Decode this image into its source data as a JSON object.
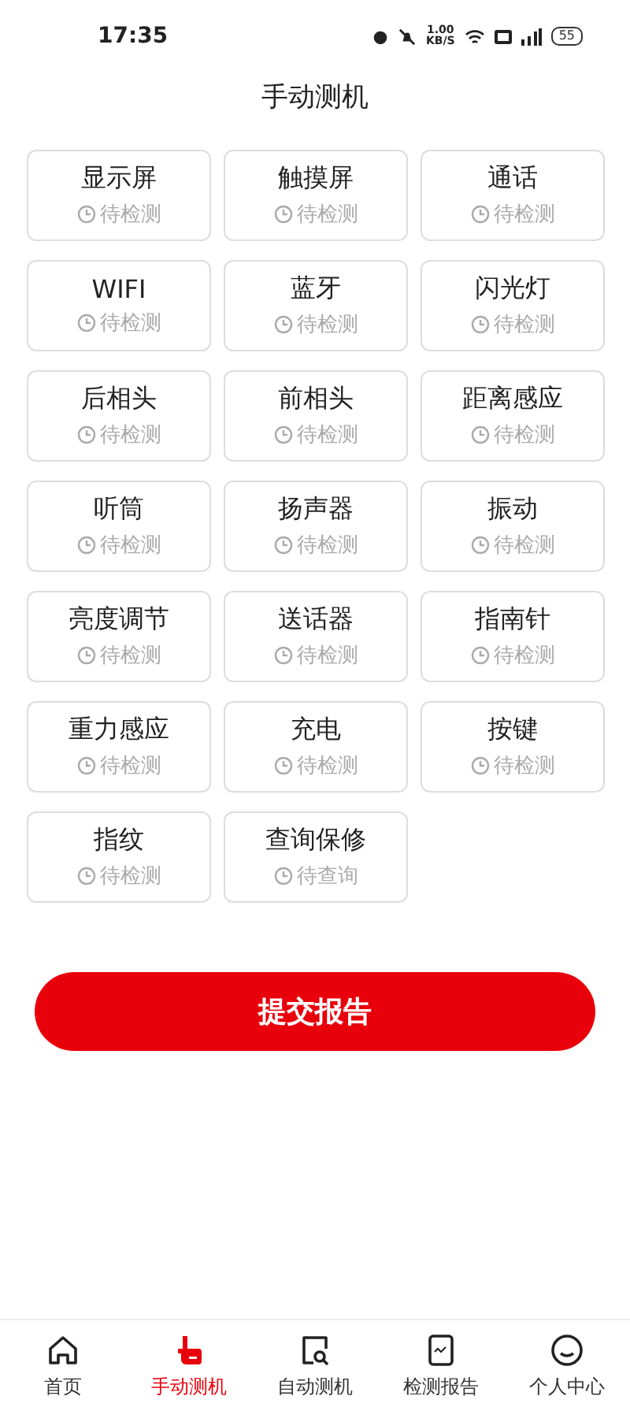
{
  "status_bar": {
    "time": "17:35",
    "net_speed": "1.00",
    "net_unit": "KB/S",
    "battery": "55"
  },
  "header": {
    "title": "手动测机"
  },
  "tests": [
    {
      "name": "显示屏",
      "status": "待检测"
    },
    {
      "name": "触摸屏",
      "status": "待检测"
    },
    {
      "name": "通话",
      "status": "待检测"
    },
    {
      "name": "WIFI",
      "status": "待检测"
    },
    {
      "name": "蓝牙",
      "status": "待检测"
    },
    {
      "name": "闪光灯",
      "status": "待检测"
    },
    {
      "name": "后相头",
      "status": "待检测"
    },
    {
      "name": "前相头",
      "status": "待检测"
    },
    {
      "name": "距离感应",
      "status": "待检测"
    },
    {
      "name": "听筒",
      "status": "待检测"
    },
    {
      "name": "扬声器",
      "status": "待检测"
    },
    {
      "name": "振动",
      "status": "待检测"
    },
    {
      "name": "亮度调节",
      "status": "待检测"
    },
    {
      "name": "送话器",
      "status": "待检测"
    },
    {
      "name": "指南针",
      "status": "待检测"
    },
    {
      "name": "重力感应",
      "status": "待检测"
    },
    {
      "name": "充电",
      "status": "待检测"
    },
    {
      "name": "按键",
      "status": "待检测"
    },
    {
      "name": "指纹",
      "status": "待检测"
    },
    {
      "name": "查询保修",
      "status": "待查询"
    }
  ],
  "submit_button": "提交报告",
  "tab_bar": [
    {
      "kind": "home",
      "label": "首页",
      "selected": false
    },
    {
      "kind": "manual",
      "label": "手动测机",
      "selected": true
    },
    {
      "kind": "auto",
      "label": "自动测机",
      "selected": false
    },
    {
      "kind": "report",
      "label": "检测报告",
      "selected": false
    },
    {
      "kind": "profile",
      "label": "个人中心",
      "selected": false
    }
  ]
}
